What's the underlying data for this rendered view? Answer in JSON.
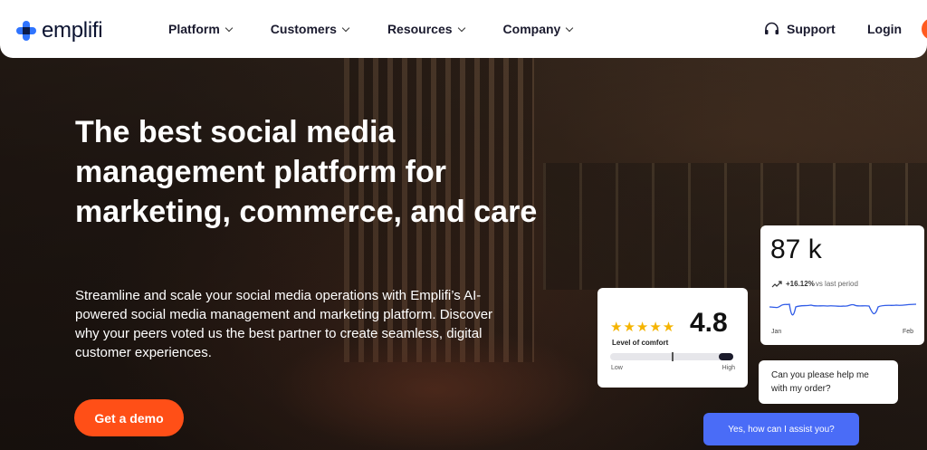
{
  "brand": {
    "name": "emplifi",
    "accent": "#ff4f17",
    "logo_blue": "#2f74ff"
  },
  "nav": {
    "items": [
      {
        "label": "Platform"
      },
      {
        "label": "Customers"
      },
      {
        "label": "Resources"
      },
      {
        "label": "Company"
      }
    ],
    "support_label": "Support",
    "login_label": "Login"
  },
  "hero": {
    "headline": "The best social media management platform for marketing, commerce, and care",
    "subtext": "Streamline and scale your social media operations with Emplifi’s AI-powered social media management and marketing platform. Discover why your peers voted us the best partner to create seamless, digital customer experiences.",
    "cta_label": "Get a demo"
  },
  "rating_card": {
    "stars": "★★★★★",
    "value": "4.8",
    "label": "Level of comfort",
    "low_label": "Low",
    "high_label": "High",
    "comfort_level": 0.88
  },
  "stats_card": {
    "value": "87 k",
    "change": "+16.12%",
    "change_suffix": "vs last period",
    "start_label": "Jan",
    "end_label": "Feb",
    "line_color": "#2f5be7"
  },
  "chat": {
    "question": "Can you please help me with my order?",
    "answer": "Yes, how can I assist you?"
  }
}
